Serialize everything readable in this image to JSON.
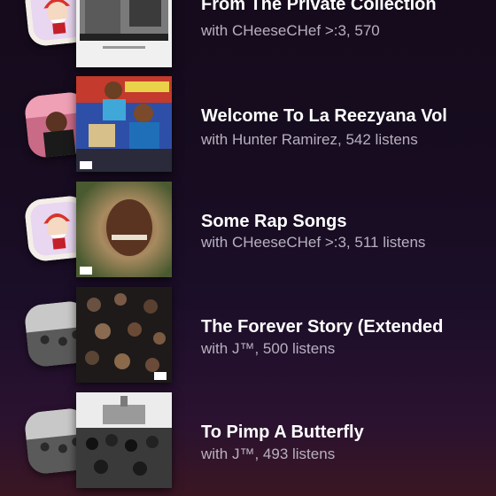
{
  "items": [
    {
      "title": "From The Private Collection",
      "subtitle_prefix": "with CHeeseCHef >:3, ",
      "subtitle_count": "570",
      "subtitle_suffix": ""
    },
    {
      "title": "Welcome To La Reezyana Vol",
      "subtitle_prefix": "with Hunter Ramirez, ",
      "subtitle_count": "542",
      "subtitle_suffix": " listens"
    },
    {
      "title": "Some Rap Songs",
      "subtitle_prefix": "with CHeeseCHef >:3, ",
      "subtitle_count": "511",
      "subtitle_suffix": " listens"
    },
    {
      "title": "The Forever Story (Extended",
      "subtitle_prefix": "with J™, ",
      "subtitle_count": "500",
      "subtitle_suffix": " listens"
    },
    {
      "title": "To Pimp A Butterfly",
      "subtitle_prefix": "with J™, ",
      "subtitle_count": "493",
      "subtitle_suffix": " listens"
    }
  ],
  "colors": {
    "title": "#ffffff",
    "subtitle": "#b8b0c0",
    "background_top": "#150b1c",
    "background_bottom": "#3a1622"
  },
  "icons": [
    "chef-avatar",
    "user-avatar",
    "album-cover",
    "explicit-badge"
  ]
}
